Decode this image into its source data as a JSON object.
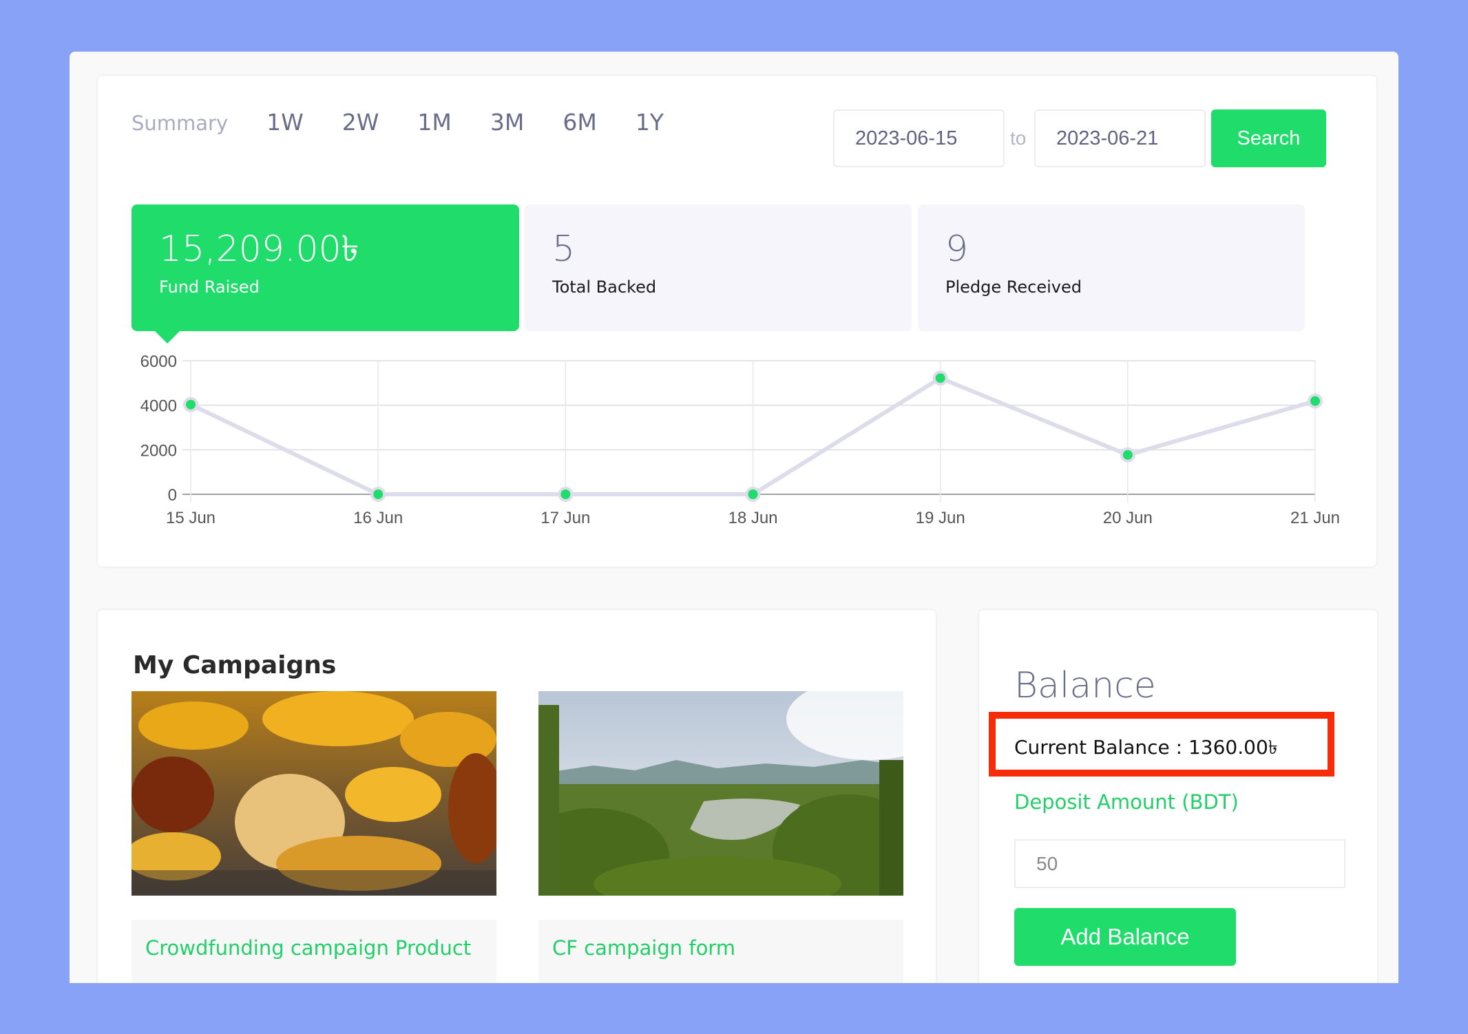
{
  "tabs": {
    "summary_label": "Summary",
    "items": [
      "1W",
      "2W",
      "1M",
      "3M",
      "6M",
      "1Y"
    ]
  },
  "date_range": {
    "from": "2023-06-15",
    "to_label": "to",
    "to": "2023-06-21",
    "search_label": "Search"
  },
  "stats": [
    {
      "value": "15,209.00৳",
      "label": "Fund Raised",
      "active": true
    },
    {
      "value": "5",
      "label": "Total Backed",
      "active": false
    },
    {
      "value": "9",
      "label": "Pledge Received",
      "active": false
    }
  ],
  "colors": {
    "accent": "#1fdc6b",
    "line": "#dcdcea",
    "highlight_box": "#f72c0b",
    "background": "#87a2f7"
  },
  "chart_data": {
    "type": "line",
    "title": "",
    "xlabel": "",
    "ylabel": "",
    "categories": [
      "15 Jun",
      "16 Jun",
      "17 Jun",
      "18 Jun",
      "19 Jun",
      "20 Jun",
      "21 Jun"
    ],
    "series": [
      {
        "name": "Fund Raised",
        "values": [
          4030,
          0,
          0,
          0,
          5220,
          1770,
          4189
        ]
      }
    ],
    "yticks": [
      0,
      2000,
      4000,
      6000
    ],
    "ylim": [
      0,
      6000
    ],
    "grid": true,
    "legend": "none"
  },
  "campaigns": {
    "title": "My Campaigns",
    "items": [
      {
        "name": "Crowdfunding campaign Product",
        "image": "autumn-leaves-photo"
      },
      {
        "name": "CF campaign form",
        "image": "forest-lake-landscape-photo"
      }
    ]
  },
  "balance": {
    "title": "Balance",
    "current_text": "Current Balance : 1360.00৳",
    "deposit_label": "Deposit Amount (BDT)",
    "deposit_value": "50",
    "add_label": "Add Balance"
  }
}
